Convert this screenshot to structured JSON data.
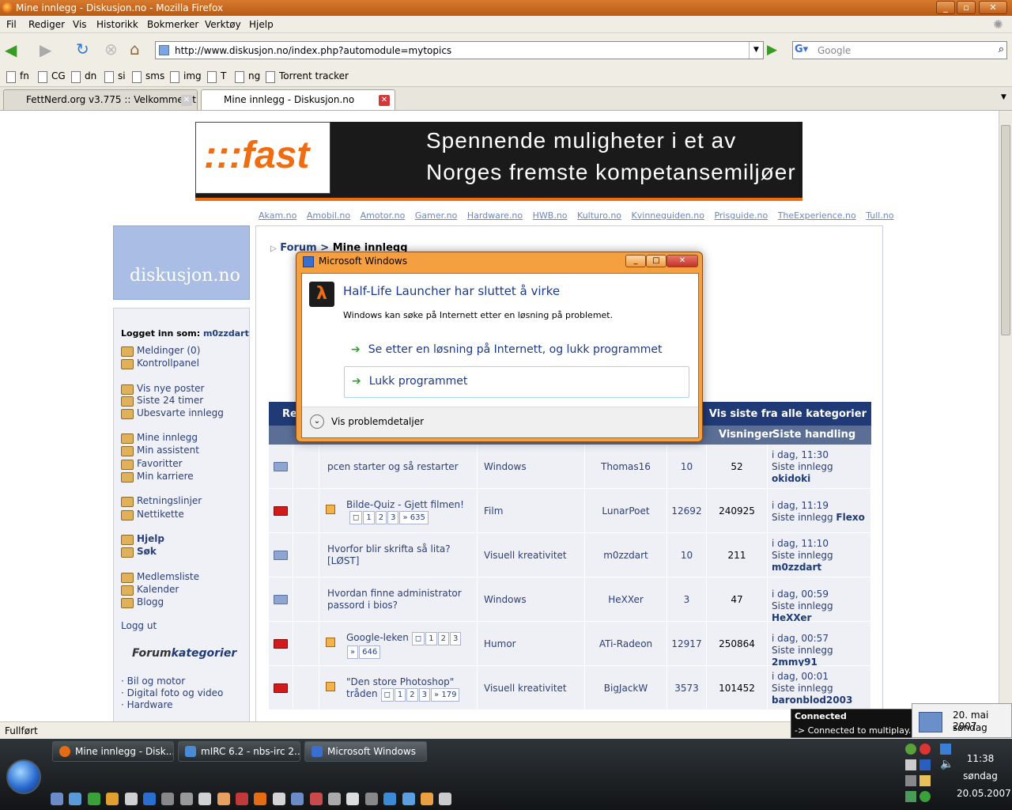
{
  "window": {
    "title": "Mine innlegg - Diskusjon.no - Mozilla Firefox"
  },
  "menu": [
    "Fil",
    "Rediger",
    "Vis",
    "Historikk",
    "Bokmerker",
    "Verktøy",
    "Hjelp"
  ],
  "nav": {
    "url": "http://www.diskusjon.no/index.php?automodule=mytopics",
    "search_placeholder": "Google"
  },
  "bookmarks": [
    "fn",
    "CG",
    "dn",
    "si",
    "sms",
    "img",
    "T",
    "ng",
    "Torrent tracker"
  ],
  "tabs": [
    {
      "label": "FettNerd.org v3.775 :: Velkommen t..."
    },
    {
      "label": "Mine innlegg - Diskusjon.no"
    }
  ],
  "banner": {
    "logo": ":::fast",
    "line1": "Spennende muligheter i et av",
    "line2": "Norges fremste kompetansemiljøer"
  },
  "sitelinks": [
    "Akam.no",
    "Amobil.no",
    "Amotor.no",
    "Gamer.no",
    "Hardware.no",
    "HWB.no",
    "Kulturo.no",
    "Kvinneguiden.no",
    "Prisguide.no",
    "TheExperience.no",
    "Tull.no"
  ],
  "sidebar": {
    "logo": "diskusjon.no",
    "logged_in_label": "Logget inn som:",
    "user": "m0zzdart",
    "items": [
      "Meldinger (0)",
      "Kontrollpanel",
      "Vis nye poster",
      "Siste 24 timer",
      "Ubesvarte innlegg",
      "Mine innlegg",
      "Min assistent",
      "Favoritter",
      "Min karriere",
      "Retningslinjer",
      "Nettikette",
      "Hjelp",
      "Søk",
      "Medlemsliste",
      "Kalender",
      "Blogg",
      "Logg ut"
    ],
    "forum_title_a": "Forum",
    "forum_title_b": "kategorier",
    "categories": [
      "· Bil og motor",
      "· Digital foto og video",
      "· Hardware"
    ]
  },
  "main": {
    "crumb_forum": "Forum",
    "crumb_sep": ">",
    "crumb_page": "Mine innlegg",
    "table_left": "Re",
    "table_right": "Vis siste fra alle kategorier",
    "col_views": "Visninger",
    "col_last": "Siste handling",
    "last_prefix": "Siste innlegg",
    "rows": [
      {
        "title": "pcen starter og så restarter",
        "forum": "Windows",
        "author": "Thomas16",
        "replies": "10",
        "views": "52",
        "date": "i dag, 11:30",
        "last": "okidoki",
        "hot": false,
        "pages": []
      },
      {
        "title": "Bilde-Quiz - Gjett filmen!",
        "forum": "Film",
        "author": "LunarPoet",
        "replies": "12692",
        "views": "240925",
        "date": "i dag, 11:19",
        "last": "Flexo",
        "hot": true,
        "pages": [
          "1",
          "2",
          "3",
          "» 635"
        ]
      },
      {
        "title": "Hvorfor blir skrifta så lita?[LØST]",
        "forum": "Visuell kreativitet",
        "author": "m0zzdart",
        "replies": "10",
        "views": "211",
        "date": "i dag, 11:10",
        "last": "m0zzdart",
        "hot": false,
        "pages": []
      },
      {
        "title": "Hvordan finne administrator passord i bios?",
        "forum": "Windows",
        "author": "HeXXer",
        "replies": "3",
        "views": "47",
        "date": "i dag, 00:59",
        "last": "HeXXer",
        "hot": false,
        "pages": []
      },
      {
        "title": "Google-leken",
        "forum": "Humor",
        "author": "ATi-Radeon",
        "replies": "12917",
        "views": "250864",
        "date": "i dag, 00:57",
        "last": "2mmy91",
        "hot": true,
        "pages": [
          "1",
          "2",
          "3",
          "»",
          "646"
        ]
      },
      {
        "title": "\"Den store Photoshop\" tråden",
        "forum": "Visuell kreativitet",
        "author": "BigJackW",
        "replies": "3573",
        "views": "101452",
        "date": "i dag, 00:01",
        "last": "baronblod2003",
        "hot": true,
        "pages": [
          "1",
          "2",
          "3",
          "» 179"
        ]
      }
    ]
  },
  "dialog": {
    "title": "Microsoft Windows",
    "heading": "Half-Life Launcher har sluttet å virke",
    "message": "Windows kan søke på Internett etter en løsning på problemet.",
    "option1": "Se etter en løsning på Internett, og lukk programmet",
    "option2": "Lukk programmet",
    "details": "Vis problemdetaljer"
  },
  "status": {
    "text": "Fullført"
  },
  "taskbar": {
    "buttons": [
      "Mine innlegg - Disk...",
      "mIRC 6.2 - nbs-irc 2....",
      "Microsoft Windows"
    ],
    "time": "11:38",
    "day": "søndag",
    "date": "20.05.2007"
  },
  "notification": {
    "title": "Connected",
    "text": "-> Connected to multiplay.uk.q"
  },
  "calendar": {
    "date": "20. mai 2007",
    "day": "søndag"
  },
  "colors": {
    "titlebar": "#c4651e",
    "link": "#1f3f7f",
    "table_header": "#1f3a76",
    "accent": "#f06c10"
  }
}
